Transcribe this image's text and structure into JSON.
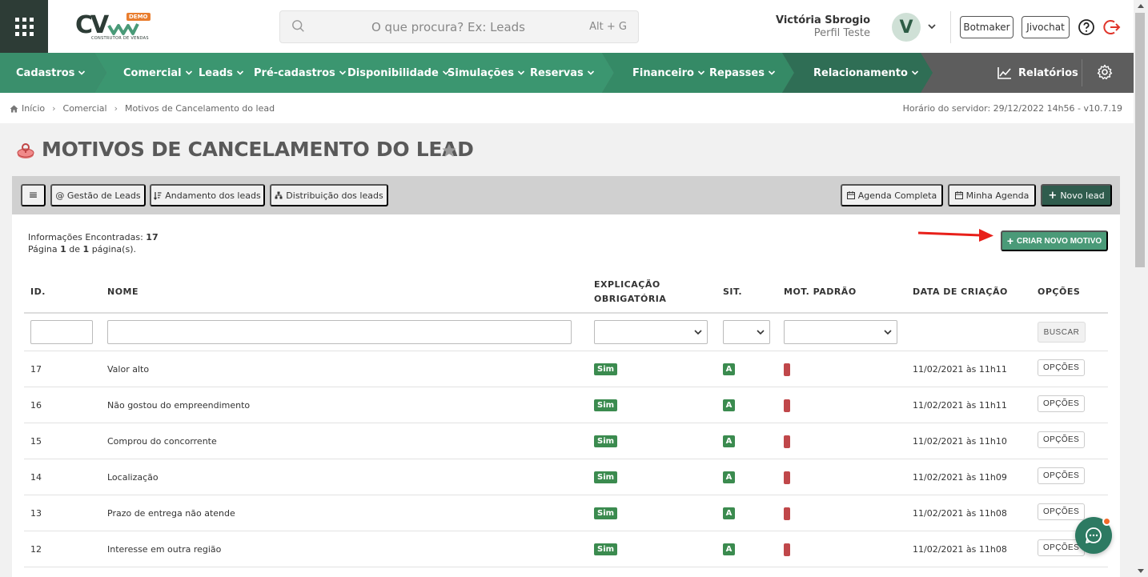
{
  "colors": {
    "brand_dark": "#2d3c36",
    "nav_green": "#3a8f6c",
    "nav_green_dark": "#2f6e55",
    "nav_gray": "#5d5d5d",
    "accent_green": "#4a9a78",
    "badge_green": "#3b8b4f",
    "red_flag": "#c0474a",
    "arrow_red": "#e8201a"
  },
  "header": {
    "logo_text": "CV",
    "logo_badge": "DEMO",
    "logo_sub": "CONSTRUTOR DE VENDAS",
    "search_placeholder": "O que procura? Ex: Leads",
    "search_shortcut": "Alt + G",
    "user_name": "Victória Sbrogio",
    "user_profile": "Perfil Teste",
    "avatar_letter": "V",
    "botmaker_label": "Botmaker",
    "jivochat_label": "Jivochat",
    "icons": [
      "apps-grid-icon",
      "search-icon",
      "chevron-down-icon",
      "help-icon",
      "logout-icon"
    ]
  },
  "nav": {
    "items": [
      {
        "label": "Cadastros"
      },
      {
        "label": "Comercial"
      },
      {
        "label": "Leads"
      },
      {
        "label": "Pré-cadastros"
      },
      {
        "label": "Disponibilidade"
      },
      {
        "label": "Simulações"
      },
      {
        "label": "Reservas"
      },
      {
        "label": "Financeiro"
      },
      {
        "label": "Repasses"
      },
      {
        "label": "Relacionamento"
      }
    ],
    "reports_label": "Relatórios"
  },
  "breadcrumb": {
    "items": [
      "Início",
      "Comercial",
      "Motivos de Cancelamento do lead"
    ],
    "server_time": "Horário do servidor: 29/12/2022 14h56 - v10.7.19"
  },
  "page": {
    "title": "MOTIVOS DE CANCELAMENTO DO LEAD"
  },
  "toolbar": {
    "menu_icon": "≡",
    "gestao": "@ Gestão de Leads",
    "andamento": "Andamento dos leads",
    "distribuicao": "Distribuição dos leads",
    "agenda_completa": "Agenda Completa",
    "minha_agenda": "Minha Agenda",
    "novo_lead": "Novo lead"
  },
  "info": {
    "found_label": "Informações Encontradas:",
    "found_count": "17",
    "page_prefix": "Página",
    "page_current": "1",
    "page_of": "de",
    "page_total": "1",
    "page_suffix": "página(s)."
  },
  "create_button": "CRIAR NOVO MOTIVO",
  "table": {
    "headers": {
      "id": "ID.",
      "nome": "NOME",
      "explicacao_1": "EXPLICAÇÃO",
      "explicacao_2": "OBRIGATÓRIA",
      "sit": "SIT.",
      "mot_padrao": "MOT. PADRÃO",
      "data": "DATA DE CRIAÇÃO",
      "opcoes": "OPÇÕES"
    },
    "search_button": "BUSCAR",
    "rows": [
      {
        "id": "17",
        "nome": "Valor alto",
        "explicacao": "Sim",
        "sit": "A",
        "data": "11/02/2021 às 11h11",
        "opcoes": "OPÇÕES"
      },
      {
        "id": "16",
        "nome": "Não gostou do empreendimento",
        "explicacao": "Sim",
        "sit": "A",
        "data": "11/02/2021 às 11h11",
        "opcoes": "OPÇÕES"
      },
      {
        "id": "15",
        "nome": "Comprou do concorrente",
        "explicacao": "Sim",
        "sit": "A",
        "data": "11/02/2021 às 11h10",
        "opcoes": "OPÇÕES"
      },
      {
        "id": "14",
        "nome": "Localização",
        "explicacao": "Sim",
        "sit": "A",
        "data": "11/02/2021 às 11h09",
        "opcoes": "OPÇÕES"
      },
      {
        "id": "13",
        "nome": "Prazo de entrega não atende",
        "explicacao": "Sim",
        "sit": "A",
        "data": "11/02/2021 às 11h08",
        "opcoes": "OPÇÕES"
      },
      {
        "id": "12",
        "nome": "Interesse em outra região",
        "explicacao": "Sim",
        "sit": "A",
        "data": "11/02/2021 às 11h08",
        "opcoes": "OPÇÕES"
      }
    ]
  }
}
